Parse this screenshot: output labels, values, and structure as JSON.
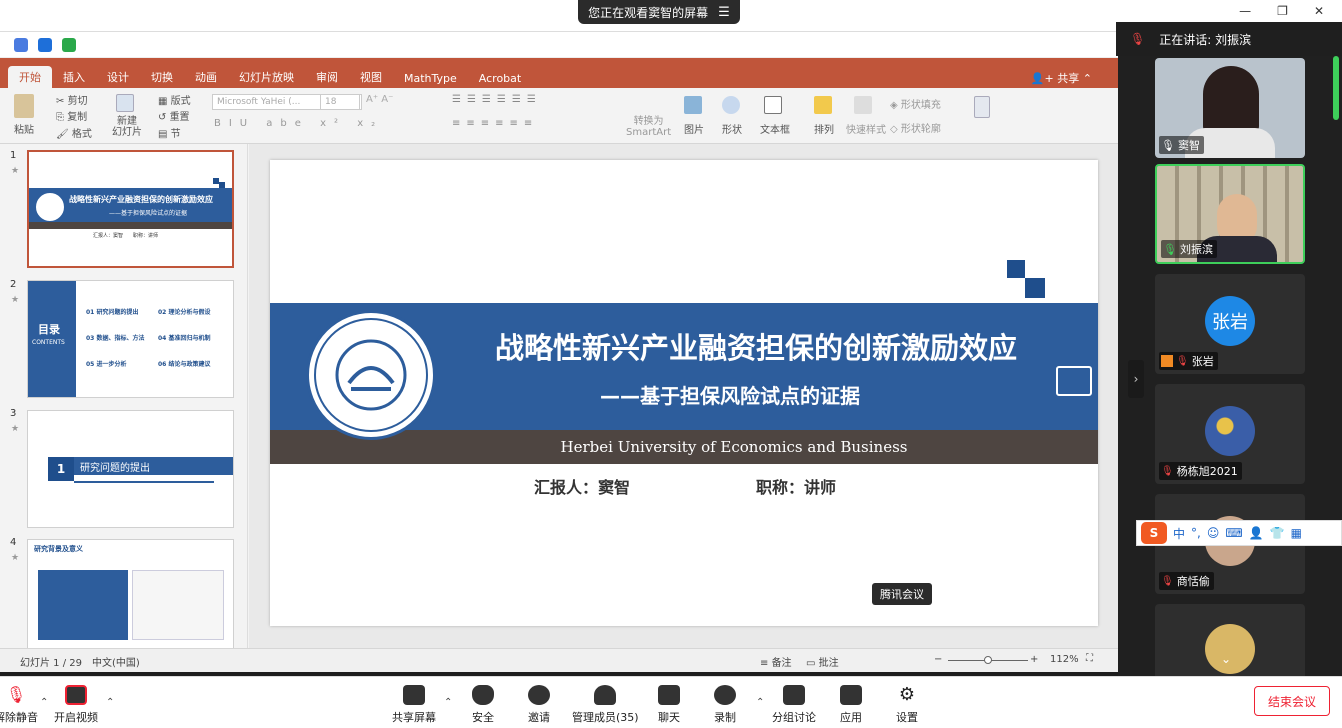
{
  "share_banner": {
    "text": "您正在观看窦智的屏幕"
  },
  "ppt": {
    "tabs": [
      "开始",
      "插入",
      "设计",
      "切换",
      "动画",
      "幻灯片放映",
      "审阅",
      "视图",
      "MathType",
      "Acrobat"
    ],
    "share_label": "共享",
    "ribbon": {
      "paste": "粘贴",
      "cut": "剪切",
      "copy": "复制",
      "format": "格式",
      "new_slide": "新建\n幻灯片",
      "layout": "版式",
      "reset": "重置",
      "section": "节",
      "font_name": "Microsoft YaHei (...",
      "font_size": "18",
      "convert_smartart": "转换为\nSmartArt",
      "picture": "图片",
      "shape": "形状",
      "textbox": "文本框",
      "arrange": "排列",
      "quick_style": "快速样式",
      "shape_fill": "形状填充",
      "shape_outline": "形状轮廓"
    },
    "thumbnails": [
      {
        "num": "1",
        "title": "战略性新兴产业融资担保的创新激励效应",
        "sub": "——基于担保风险试点的证据",
        "foot": "汇报人：窦智　　职称：讲师"
      },
      {
        "num": "2",
        "heading": "目录",
        "heading_en": "CONTENTS",
        "items": [
          "01 研究问题的提出",
          "02 理论分析与假设",
          "03 数据、指标、方法",
          "04 基准回归与机制",
          "05 进一步分析",
          "06 结论与政策建议"
        ]
      },
      {
        "num": "3",
        "idx": "1",
        "title": "研究问题的提出"
      },
      {
        "num": "4",
        "title": "研究背景及意义"
      }
    ],
    "slide": {
      "title": "战略性新兴产业融资担保的创新激励效应",
      "subtitle": "——基于担保风险试点的证据",
      "university": "Herbei University of Economics and Business",
      "reporter": "汇报人：窦智",
      "job_title": "职称：讲师"
    },
    "status": {
      "slide_count": "幻灯片 1 / 29",
      "language": "中文(中国)",
      "notes": "备注",
      "comments": "批注",
      "zoom": "112%"
    },
    "tooltip": "腾讯会议"
  },
  "meeting": {
    "speaking": "正在讲话: 刘振滨",
    "participants": [
      {
        "name": "窦智",
        "mic": "on"
      },
      {
        "name": "刘振滨",
        "mic": "on"
      },
      {
        "name": "张岩",
        "mic": "off",
        "avatar_text": "张岩",
        "avatar_color": "#1e88e5"
      },
      {
        "name": "杨栋旭2021",
        "mic": "off"
      },
      {
        "name": "商恬偷",
        "mic": "off"
      },
      {
        "name": "",
        "mic": "off"
      }
    ],
    "ime": {
      "logo": "S",
      "lang": "中",
      "punct": "°,"
    },
    "toolbar": {
      "mute": "解除静音",
      "video": "开启视频",
      "share": "共享屏幕",
      "security": "安全",
      "invite": "邀请",
      "members": "管理成员(35)",
      "chat": "聊天",
      "record": "录制",
      "breakout": "分组讨论",
      "apps": "应用",
      "settings": "设置",
      "end": "结束会议"
    }
  }
}
